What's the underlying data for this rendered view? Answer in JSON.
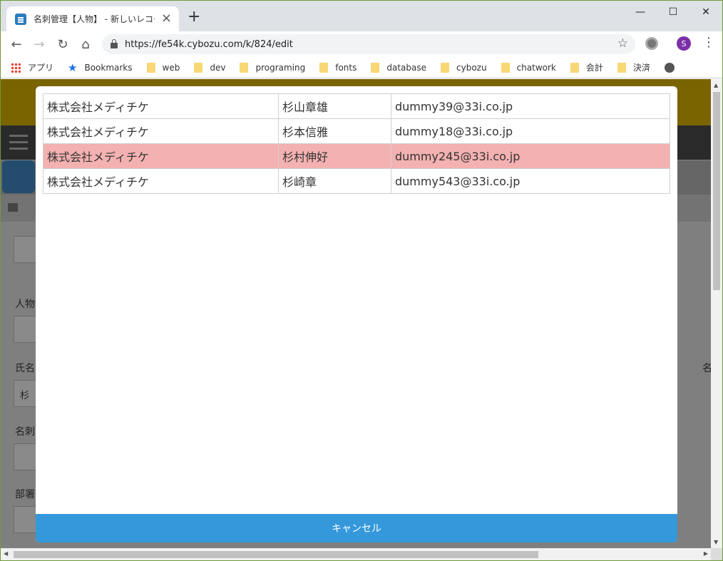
{
  "browser": {
    "tab_title": "名刺管理【人物】 - 新しいレコード",
    "url": "https://fe54k.cybozu.com/k/824/edit",
    "avatar_initial": "S"
  },
  "bookmarks": [
    {
      "label": "アプリ",
      "icon": "apps-grid-icon"
    },
    {
      "label": "Bookmarks",
      "icon": "star-icon"
    },
    {
      "label": "web",
      "icon": "folder-icon"
    },
    {
      "label": "dev",
      "icon": "folder-icon"
    },
    {
      "label": "programing",
      "icon": "folder-icon"
    },
    {
      "label": "fonts",
      "icon": "folder-icon"
    },
    {
      "label": "database",
      "icon": "folder-icon"
    },
    {
      "label": "cybozu",
      "icon": "folder-icon"
    },
    {
      "label": "chatwork",
      "icon": "folder-icon"
    },
    {
      "label": "会計",
      "icon": "folder-icon"
    },
    {
      "label": "決済",
      "icon": "folder-icon"
    }
  ],
  "page": {
    "labels": [
      "人物",
      "氏名",
      "名刺",
      "部署"
    ],
    "field_value": "杉",
    "right_label": "名"
  },
  "modal": {
    "rows": [
      {
        "company": "株式会社メディチケ",
        "name": "杉山章雄",
        "email": "dummy39@33i.co.jp",
        "selected": false
      },
      {
        "company": "株式会社メディチケ",
        "name": "杉本信雅",
        "email": "dummy18@33i.co.jp",
        "selected": false
      },
      {
        "company": "株式会社メディチケ",
        "name": "杉村伸好",
        "email": "dummy245@33i.co.jp",
        "selected": true
      },
      {
        "company": "株式会社メディチケ",
        "name": "杉崎章",
        "email": "dummy543@33i.co.jp",
        "selected": false
      }
    ],
    "cancel_label": "キャンセル"
  },
  "colors": {
    "selected_row": "#f4b1b1",
    "cancel_button": "#3498db"
  }
}
